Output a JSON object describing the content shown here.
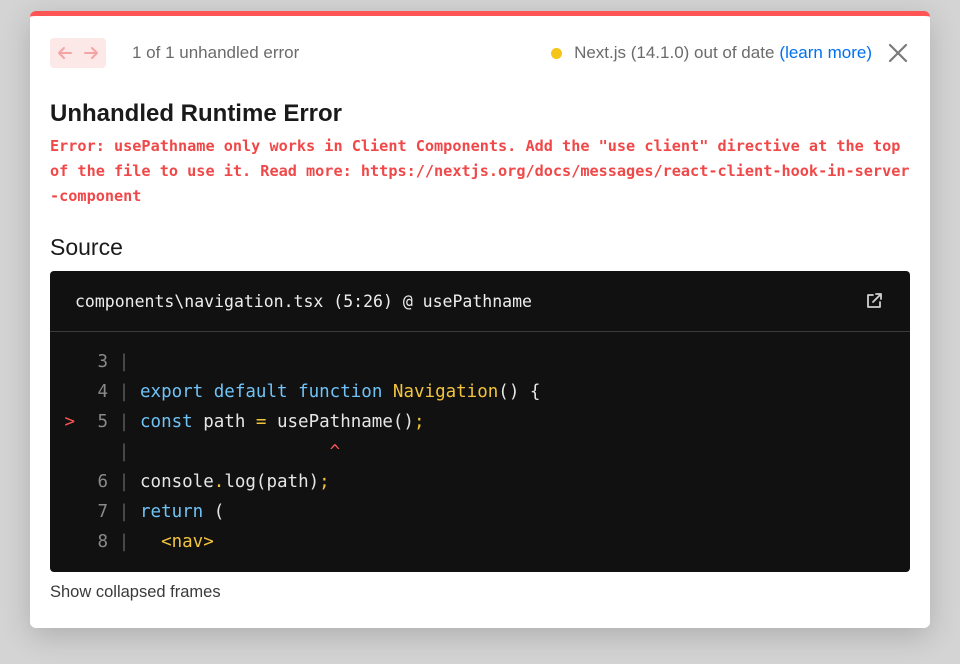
{
  "topbar": {
    "counter": "1 of 1 unhandled error",
    "version": "Next.js (14.1.0) out of date",
    "learn_more": "(learn more)",
    "status_dot_color": "#f5c518",
    "icons": {
      "prev": "arrow-left-icon",
      "next": "arrow-right-icon",
      "close": "close-icon"
    }
  },
  "error": {
    "title": "Unhandled Runtime Error",
    "message": "Error: usePathname only works in Client Components. Add the \"use client\" directive at the top of the file to use it. Read more: https://nextjs.org/docs/messages/react-client-hook-in-server-component"
  },
  "source": {
    "heading": "Source",
    "file_ref": "components\\navigation.tsx (5:26) @ usePathname",
    "open_icon": "external-link-icon",
    "lines": [
      {
        "num": "3",
        "tokens": []
      },
      {
        "num": "4",
        "tokens": [
          {
            "t": "export",
            "c": "kw"
          },
          {
            "t": " ",
            "c": "code"
          },
          {
            "t": "default",
            "c": "kw"
          },
          {
            "t": " ",
            "c": "code"
          },
          {
            "t": "function",
            "c": "kw"
          },
          {
            "t": " ",
            "c": "code"
          },
          {
            "t": "Navigation",
            "c": "fn"
          },
          {
            "t": "() {",
            "c": "code"
          }
        ]
      },
      {
        "num": "5",
        "marker": ">",
        "tokens": [
          {
            "t": "const",
            "c": "kw"
          },
          {
            "t": " path ",
            "c": "code"
          },
          {
            "t": "=",
            "c": "op"
          },
          {
            "t": " usePathname()",
            "c": "code"
          },
          {
            "t": ";",
            "c": "op"
          }
        ]
      },
      {
        "num": "",
        "tokens": [
          {
            "t": "                  ",
            "c": "code"
          },
          {
            "t": "^",
            "c": "caret"
          }
        ]
      },
      {
        "num": "6",
        "tokens": [
          {
            "t": "console",
            "c": "code"
          },
          {
            "t": ".",
            "c": "op"
          },
          {
            "t": "log(path)",
            "c": "code"
          },
          {
            "t": ";",
            "c": "op"
          }
        ]
      },
      {
        "num": "7",
        "tokens": [
          {
            "t": "return",
            "c": "kw"
          },
          {
            "t": " (",
            "c": "code"
          }
        ]
      },
      {
        "num": "8",
        "tokens": [
          {
            "t": "  ",
            "c": "code"
          },
          {
            "t": "<nav>",
            "c": "fn"
          }
        ]
      }
    ]
  },
  "footer": {
    "show_collapsed": "Show collapsed frames"
  },
  "colors": {
    "accent_red": "#ff5555",
    "link_blue": "#0070f3",
    "code_bg": "#111111"
  }
}
